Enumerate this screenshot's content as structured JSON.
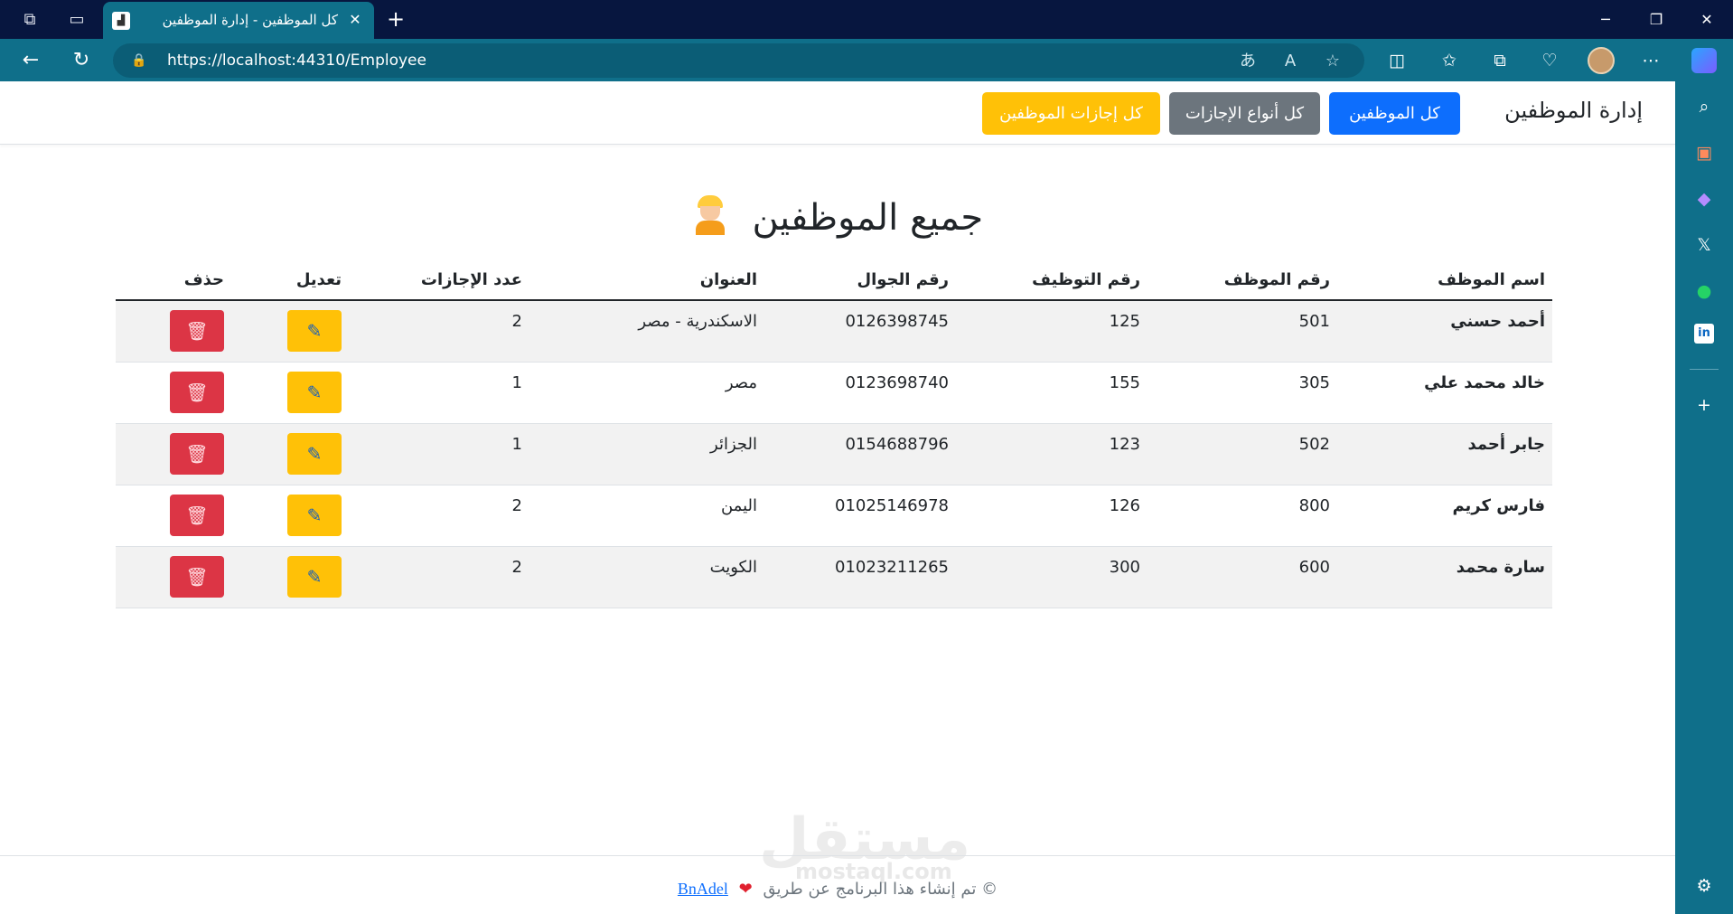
{
  "browser": {
    "tab_title": "كل الموظفين - إدارة الموظفين",
    "url": "https://localhost:44310/Employee"
  },
  "navbar": {
    "brand": "إدارة الموظفين",
    "buttons": [
      {
        "label": "كل الموظفين",
        "style": "primary"
      },
      {
        "label": "كل أنواع الإجازات",
        "style": "secondary"
      },
      {
        "label": "كل إجازات الموظفين",
        "style": "warning"
      }
    ]
  },
  "page": {
    "title": "جميع الموظفين",
    "title_emoji": "construction-worker"
  },
  "table": {
    "headers": [
      "اسم الموظف",
      "رقم الموظف",
      "رقم التوظيف",
      "رقم الجوال",
      "العنوان",
      "عدد الإجازات",
      "تعديل",
      "حذف"
    ],
    "rows": [
      {
        "name": "أحمد حسني",
        "emp_no": "501",
        "hire_no": "125",
        "mobile": "0126398745",
        "address": "الاسكندرية - مصر",
        "leaves": "2"
      },
      {
        "name": "خالد محمد علي",
        "emp_no": "305",
        "hire_no": "155",
        "mobile": "0123698740",
        "address": "مصر",
        "leaves": "1"
      },
      {
        "name": "جابر أحمد",
        "emp_no": "502",
        "hire_no": "123",
        "mobile": "0154688796",
        "address": "الجزائر",
        "leaves": "1"
      },
      {
        "name": "فارس كريم",
        "emp_no": "800",
        "hire_no": "126",
        "mobile": "01025146978",
        "address": "اليمن",
        "leaves": "2"
      },
      {
        "name": "سارة محمد",
        "emp_no": "600",
        "hire_no": "300",
        "mobile": "01023211265",
        "address": "الكويت",
        "leaves": "2"
      }
    ]
  },
  "footer": {
    "text": "© تم إنشاء هذا البرنامج عن طريق",
    "author": "BnAdel"
  },
  "watermark": {
    "text": "مستقل",
    "sub": "mostaql.com"
  },
  "colors": {
    "primary": "#0d6efd",
    "secondary": "#6c757d",
    "warning": "#ffc107",
    "danger": "#dc3545",
    "browser_chrome": "#0f6f8a"
  }
}
